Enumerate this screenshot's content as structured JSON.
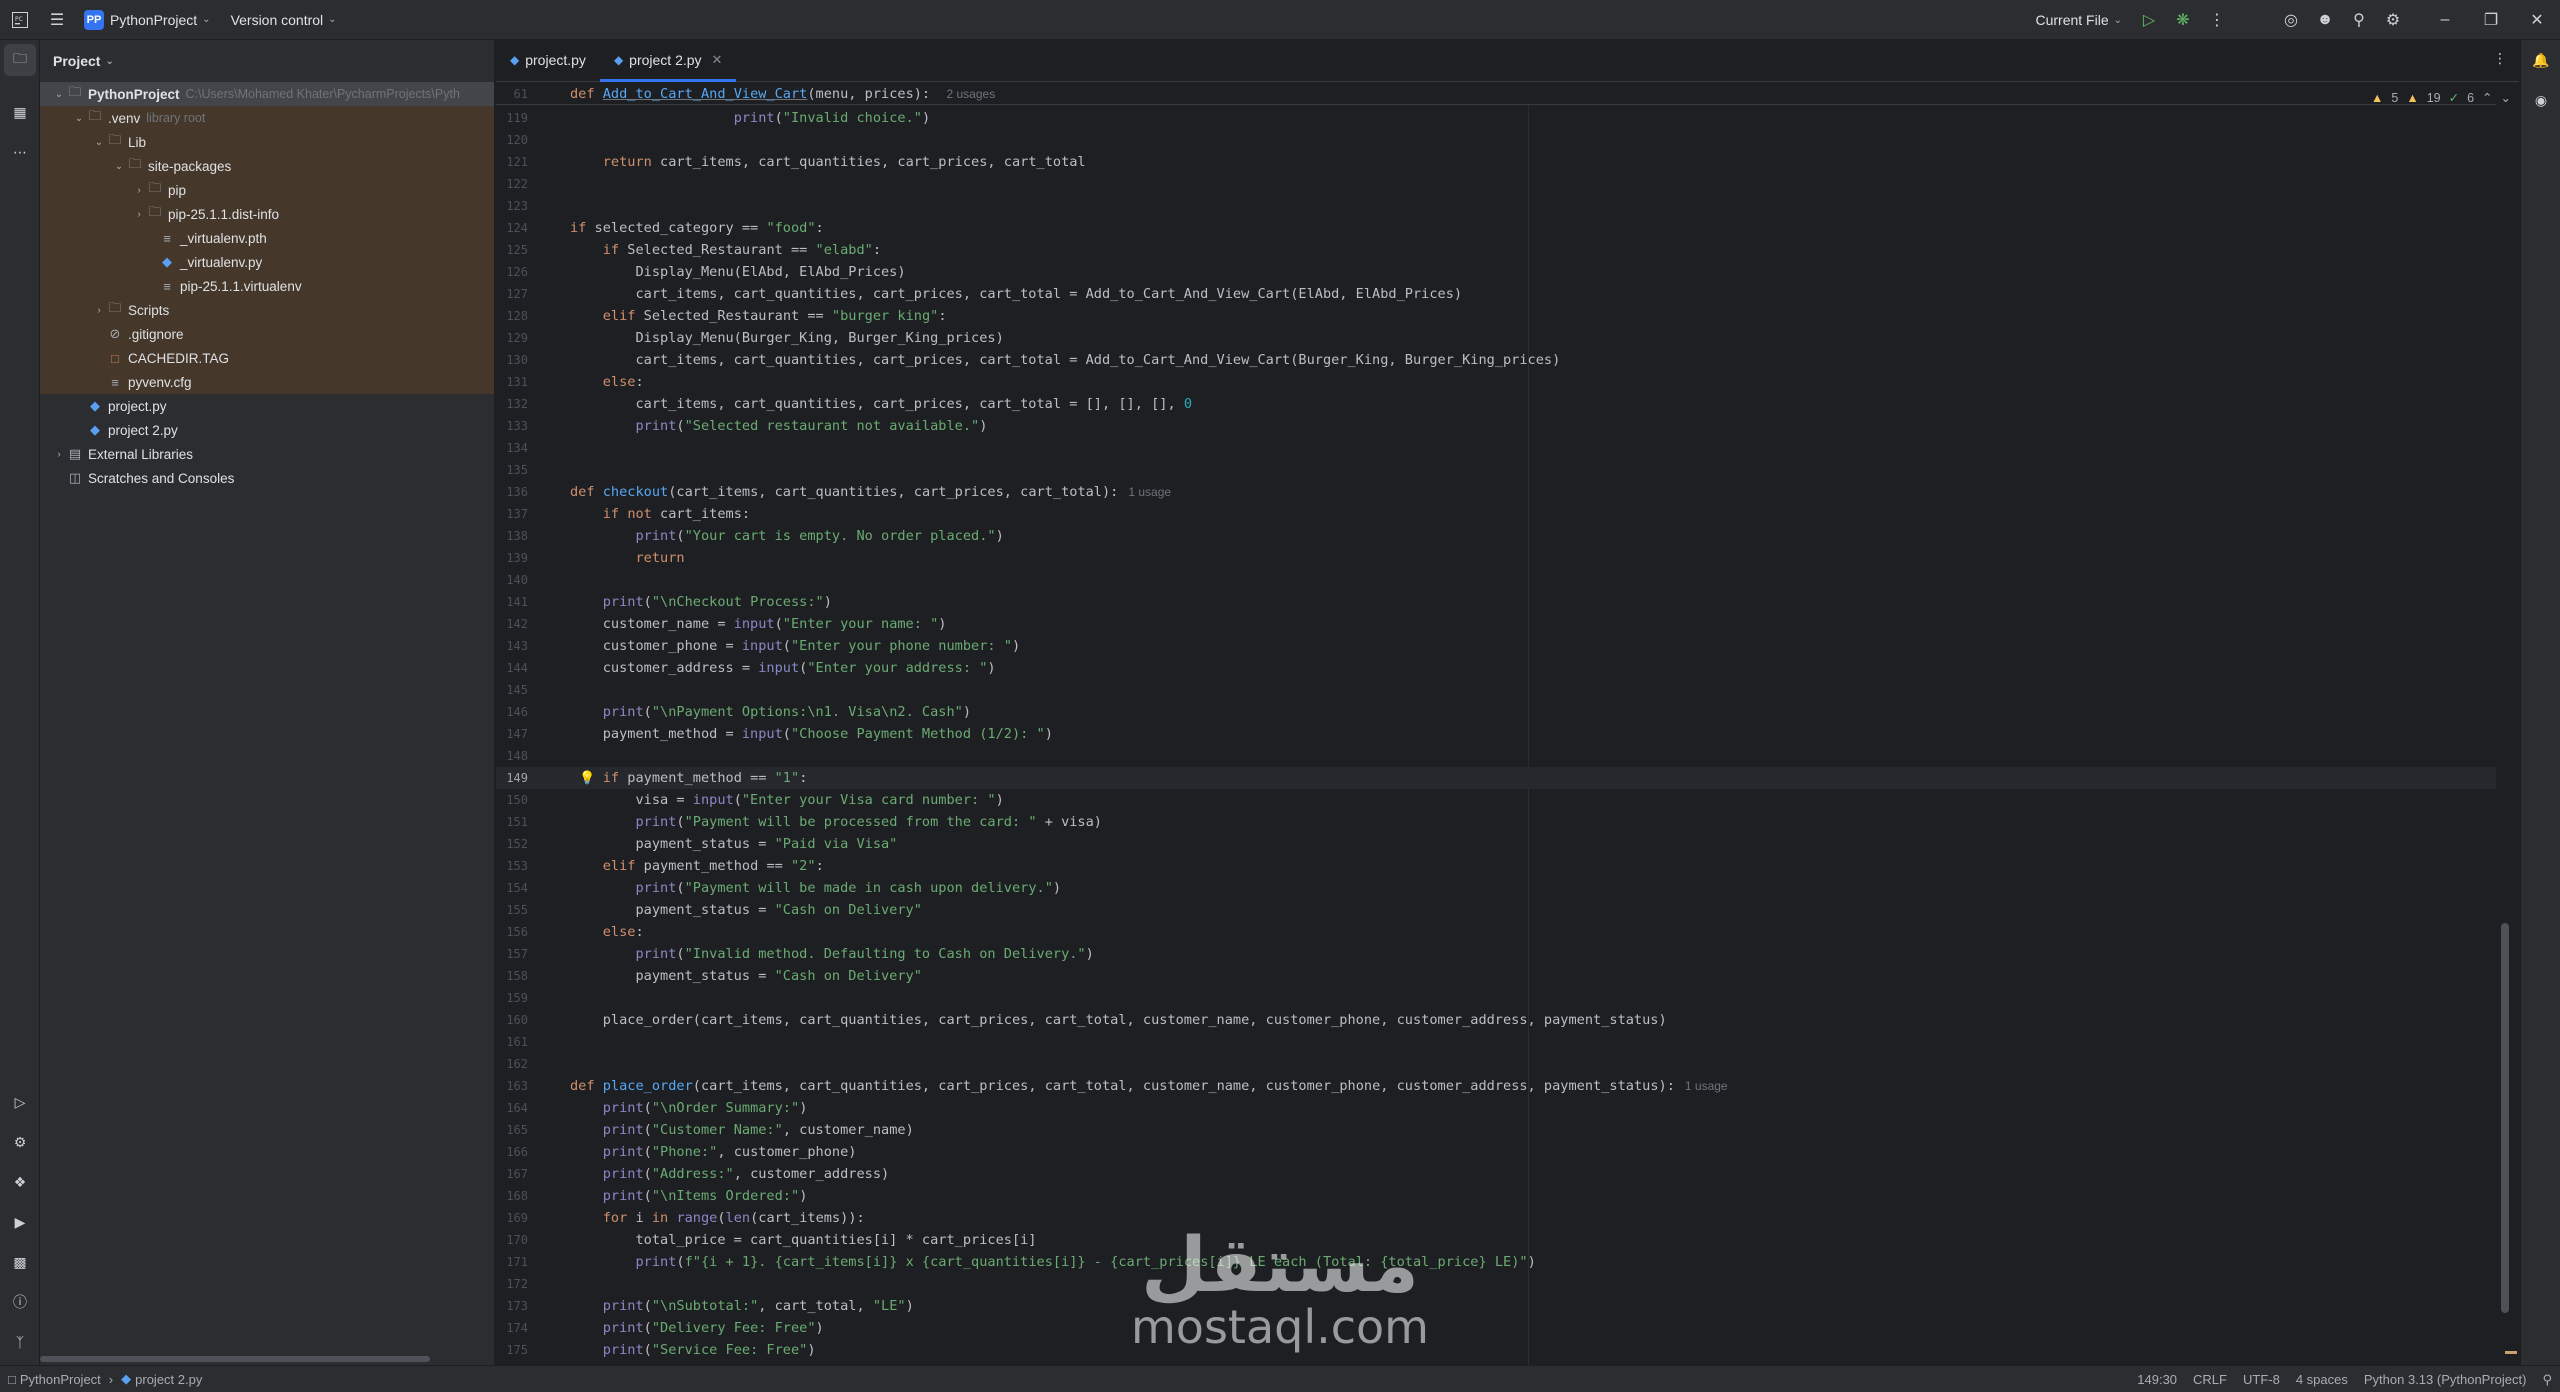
{
  "titlebar": {
    "project_badge": "PP",
    "project_name": "PythonProject",
    "vcs": "Version control",
    "run_config": "Current File"
  },
  "project_panel": {
    "title": "Project",
    "tree": [
      {
        "label": "PythonProject",
        "extra": "C:\\Users\\Mohamed Khater\\PycharmProjects\\Pyth",
        "icon": "folder",
        "expanded": true
      },
      {
        "label": ".venv",
        "extra": "library root",
        "icon": "folder",
        "expanded": true
      },
      {
        "label": "Lib",
        "extra": "",
        "icon": "folder",
        "expanded": true
      },
      {
        "label": "site-packages",
        "extra": "",
        "icon": "folder",
        "expanded": true
      },
      {
        "label": "pip",
        "extra": "",
        "icon": "folder",
        "expanded": false
      },
      {
        "label": "pip-25.1.1.dist-info",
        "extra": "",
        "icon": "folder",
        "expanded": false
      },
      {
        "label": "_virtualenv.pth",
        "extra": "",
        "icon": "file"
      },
      {
        "label": "_virtualenv.py",
        "extra": "",
        "icon": "python"
      },
      {
        "label": "pip-25.1.1.virtualenv",
        "extra": "",
        "icon": "file"
      },
      {
        "label": "Scripts",
        "extra": "",
        "icon": "folder",
        "expanded": false
      },
      {
        "label": ".gitignore",
        "extra": "",
        "icon": "ignore"
      },
      {
        "label": "CACHEDIR.TAG",
        "extra": "",
        "icon": "tag"
      },
      {
        "label": "pyvenv.cfg",
        "extra": "",
        "icon": "file"
      },
      {
        "label": "project.py",
        "extra": "",
        "icon": "python"
      },
      {
        "label": "project 2.py",
        "extra": "",
        "icon": "python"
      },
      {
        "label": "External Libraries",
        "extra": "",
        "icon": "library",
        "expanded": false
      },
      {
        "label": "Scratches and Consoles",
        "extra": "",
        "icon": "scratch"
      }
    ]
  },
  "editor": {
    "tabs": [
      {
        "label": "project.py",
        "active": false
      },
      {
        "label": "project 2.py",
        "active": true
      }
    ],
    "inspections": {
      "warnings": "5",
      "weak_warnings": "19",
      "ok": "6"
    },
    "sticky": {
      "number": "61",
      "code": "def Add_to_Cart_And_View_Cart(menu, prices):",
      "hint": "2 usages"
    },
    "current_line": 149,
    "lines": [
      {
        "n": "119",
        "c": "                    print(\"Invalid choice.\")"
      },
      {
        "n": "120",
        "c": ""
      },
      {
        "n": "121",
        "c": "    return cart_items, cart_quantities, cart_prices, cart_total"
      },
      {
        "n": "122",
        "c": ""
      },
      {
        "n": "123",
        "c": ""
      },
      {
        "n": "124",
        "c": "if selected_category == \"food\":"
      },
      {
        "n": "125",
        "c": "    if Selected_Restaurant == \"elabd\":"
      },
      {
        "n": "126",
        "c": "        Display_Menu(ElAbd, ElAbd_Prices)"
      },
      {
        "n": "127",
        "c": "        cart_items, cart_quantities, cart_prices, cart_total = Add_to_Cart_And_View_Cart(ElAbd, ElAbd_Prices)"
      },
      {
        "n": "128",
        "c": "    elif Selected_Restaurant == \"burger king\":"
      },
      {
        "n": "129",
        "c": "        Display_Menu(Burger_King, Burger_King_prices)"
      },
      {
        "n": "130",
        "c": "        cart_items, cart_quantities, cart_prices, cart_total = Add_to_Cart_And_View_Cart(Burger_King, Burger_King_prices)"
      },
      {
        "n": "131",
        "c": "    else:"
      },
      {
        "n": "132",
        "c": "        cart_items, cart_quantities, cart_prices, cart_total = [], [], [], 0"
      },
      {
        "n": "133",
        "c": "        print(\"Selected restaurant not available.\")"
      },
      {
        "n": "134",
        "c": ""
      },
      {
        "n": "135",
        "c": ""
      },
      {
        "n": "136",
        "c": "def checkout(cart_items, cart_quantities, cart_prices, cart_total):",
        "hint": "1 usage"
      },
      {
        "n": "137",
        "c": "    if not cart_items:"
      },
      {
        "n": "138",
        "c": "        print(\"Your cart is empty. No order placed.\")"
      },
      {
        "n": "139",
        "c": "        return"
      },
      {
        "n": "140",
        "c": ""
      },
      {
        "n": "141",
        "c": "    print(\"\\nCheckout Process:\")"
      },
      {
        "n": "142",
        "c": "    customer_name = input(\"Enter your name: \")"
      },
      {
        "n": "143",
        "c": "    customer_phone = input(\"Enter your phone number: \")"
      },
      {
        "n": "144",
        "c": "    customer_address = input(\"Enter your address: \")"
      },
      {
        "n": "145",
        "c": ""
      },
      {
        "n": "146",
        "c": "    print(\"\\nPayment Options:\\n1. Visa\\n2. Cash\")"
      },
      {
        "n": "147",
        "c": "    payment_method = input(\"Choose Payment Method (1/2): \")"
      },
      {
        "n": "148",
        "c": ""
      },
      {
        "n": "149",
        "c": "    if payment_method == \"1\":"
      },
      {
        "n": "150",
        "c": "        visa = input(\"Enter your Visa card number: \")"
      },
      {
        "n": "151",
        "c": "        print(\"Payment will be processed from the card: \" + visa)"
      },
      {
        "n": "152",
        "c": "        payment_status = \"Paid via Visa\""
      },
      {
        "n": "153",
        "c": "    elif payment_method == \"2\":"
      },
      {
        "n": "154",
        "c": "        print(\"Payment will be made in cash upon delivery.\")"
      },
      {
        "n": "155",
        "c": "        payment_status = \"Cash on Delivery\""
      },
      {
        "n": "156",
        "c": "    else:"
      },
      {
        "n": "157",
        "c": "        print(\"Invalid method. Defaulting to Cash on Delivery.\")"
      },
      {
        "n": "158",
        "c": "        payment_status = \"Cash on Delivery\""
      },
      {
        "n": "159",
        "c": ""
      },
      {
        "n": "160",
        "c": "    place_order(cart_items, cart_quantities, cart_prices, cart_total, customer_name, customer_phone, customer_address, payment_status)"
      },
      {
        "n": "161",
        "c": ""
      },
      {
        "n": "162",
        "c": ""
      },
      {
        "n": "163",
        "c": "def place_order(cart_items, cart_quantities, cart_prices, cart_total, customer_name, customer_phone, customer_address, payment_status):",
        "hint": "1 usage"
      },
      {
        "n": "164",
        "c": "    print(\"\\nOrder Summary:\")"
      },
      {
        "n": "165",
        "c": "    print(\"Customer Name:\", customer_name)"
      },
      {
        "n": "166",
        "c": "    print(\"Phone:\", customer_phone)"
      },
      {
        "n": "167",
        "c": "    print(\"Address:\", customer_address)"
      },
      {
        "n": "168",
        "c": "    print(\"\\nItems Ordered:\")"
      },
      {
        "n": "169",
        "c": "    for i in range(len(cart_items)):"
      },
      {
        "n": "170",
        "c": "        total_price = cart_quantities[i] * cart_prices[i]"
      },
      {
        "n": "171",
        "c": "        print(f\"{i + 1}. {cart_items[i]} x {cart_quantities[i]} - {cart_prices[i]} LE each (Total: {total_price} LE)\")"
      },
      {
        "n": "172",
        "c": ""
      },
      {
        "n": "173",
        "c": "    print(\"\\nSubtotal:\", cart_total, \"LE\")"
      },
      {
        "n": "174",
        "c": "    print(\"Delivery Fee: Free\")"
      },
      {
        "n": "175",
        "c": "    print(\"Service Fee: Free\")"
      }
    ]
  },
  "watermark": {
    "arabic": "مستقل",
    "latin": "mostaql.com"
  },
  "statusbar": {
    "breadcrumb_project": "PythonProject",
    "breadcrumb_file": "project 2.py",
    "position": "149:30",
    "line_sep": "CRLF",
    "encoding": "UTF-8",
    "indent": "4 spaces",
    "interpreter": "Python 3.13 (PythonProject)"
  }
}
